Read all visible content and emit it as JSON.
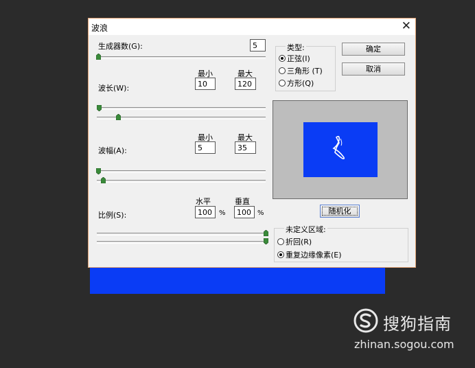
{
  "dialog": {
    "title": "波浪",
    "close_glyph": "✕",
    "generators": {
      "label": "生成器数(G):",
      "value": "5"
    },
    "wavelength": {
      "label": "波长(W):",
      "min_label": "最小",
      "max_label": "最大",
      "min": "10",
      "max": "120"
    },
    "amplitude": {
      "label": "波幅(A):",
      "min_label": "最小",
      "max_label": "最大",
      "min": "5",
      "max": "35"
    },
    "scale": {
      "label": "比例(S):",
      "h_label": "水平",
      "v_label": "垂直",
      "h": "100",
      "v": "100",
      "unit": "%"
    },
    "type_group": {
      "title": "类型:",
      "options": [
        {
          "label": "正弦(I)",
          "selected": true
        },
        {
          "label": "三角形 (T)",
          "selected": false
        },
        {
          "label": "方形(Q)",
          "selected": false
        }
      ]
    },
    "ok_label": "确定",
    "cancel_label": "取消",
    "randomize_label": "随机化",
    "undefined_group": {
      "title": "未定义区域:",
      "options": [
        {
          "label": "折回(R)",
          "selected": false
        },
        {
          "label": "重复边缘像素(E)",
          "selected": true
        }
      ]
    }
  },
  "watermark": {
    "name": "搜狗指南",
    "url": "zhinan.sogou.com"
  },
  "colors": {
    "canvas_blue": "#0a3cf5",
    "background": "#2b2b2b",
    "dialog": "#f0f0f0"
  }
}
